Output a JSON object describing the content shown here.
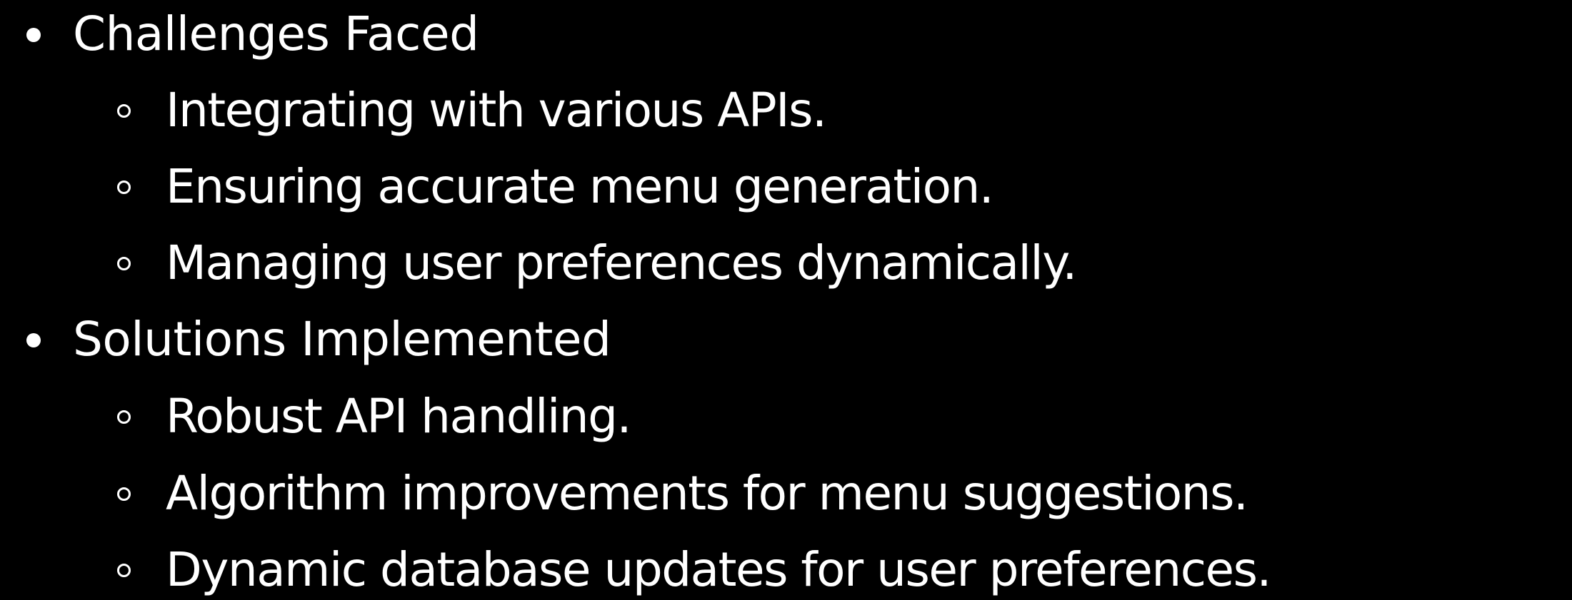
{
  "outline": {
    "sections": [
      {
        "heading": "Challenges Faced",
        "points": [
          "Integrating with various APIs.",
          "Ensuring accurate menu generation.",
          "Managing user preferences dynamically."
        ]
      },
      {
        "heading": "Solutions Implemented",
        "points": [
          "Robust API handling.",
          "Algorithm improvements for menu suggestions.",
          "Dynamic database updates for user preferences."
        ]
      }
    ]
  },
  "colors": {
    "background": "#000000",
    "text": "#ffffff"
  },
  "icons": {
    "level1_bullet": "filled-circle-icon",
    "level2_bullet": "hollow-circle-icon"
  }
}
